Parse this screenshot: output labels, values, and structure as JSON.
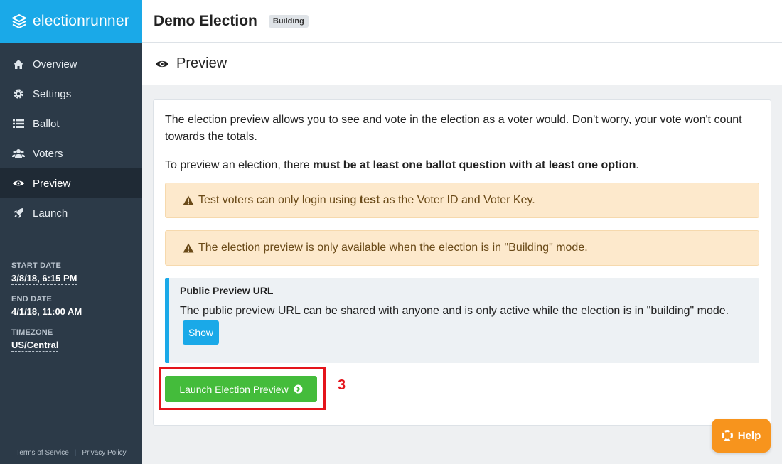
{
  "brand": {
    "prefix": "election",
    "suffix": "runner"
  },
  "sidebar": {
    "items": [
      {
        "label": "Overview",
        "icon": "home-icon"
      },
      {
        "label": "Settings",
        "icon": "gear-icon"
      },
      {
        "label": "Ballot",
        "icon": "list-icon"
      },
      {
        "label": "Voters",
        "icon": "users-icon"
      },
      {
        "label": "Preview",
        "icon": "eye-icon",
        "active": true
      },
      {
        "label": "Launch",
        "icon": "rocket-icon"
      }
    ],
    "meta": {
      "start_label": "START DATE",
      "start_value": "3/8/18, 6:15 PM",
      "end_label": "END DATE",
      "end_value": "4/1/18, 11:00 AM",
      "tz_label": "TIMEZONE",
      "tz_value": "US/Central"
    },
    "footer": {
      "terms": "Terms of Service",
      "privacy": "Privacy Policy"
    }
  },
  "header": {
    "title": "Demo Election",
    "status_badge": "Building"
  },
  "page": {
    "title": "Preview"
  },
  "content": {
    "intro": "The election preview allows you to see and vote in the election as a voter would. Don't worry, your vote won't count towards the totals.",
    "req_pre": "To preview an election, there ",
    "req_bold": "must be at least one ballot question with at least one option",
    "req_post": ".",
    "warn1_pre": "Test voters can only login using ",
    "warn1_bold": "test",
    "warn1_post": " as the Voter ID and Voter Key.",
    "warn2": "The election preview is only available when the election is in \"Building\" mode.",
    "callout_title": "Public Preview URL",
    "callout_text": "The public preview URL can be shared with anyone and is only active while the election is in \"building\" mode.",
    "show_button": "Show",
    "launch_button": "Launch Election Preview",
    "annotation": "3"
  },
  "help": {
    "label": "Help"
  },
  "colors": {
    "brand": "#1aa9e8",
    "sidebar": "#2c3a48",
    "success": "#44bc3b",
    "warning_bg": "#fde9cc",
    "help": "#f7941d",
    "annotation": "#e4141b"
  }
}
